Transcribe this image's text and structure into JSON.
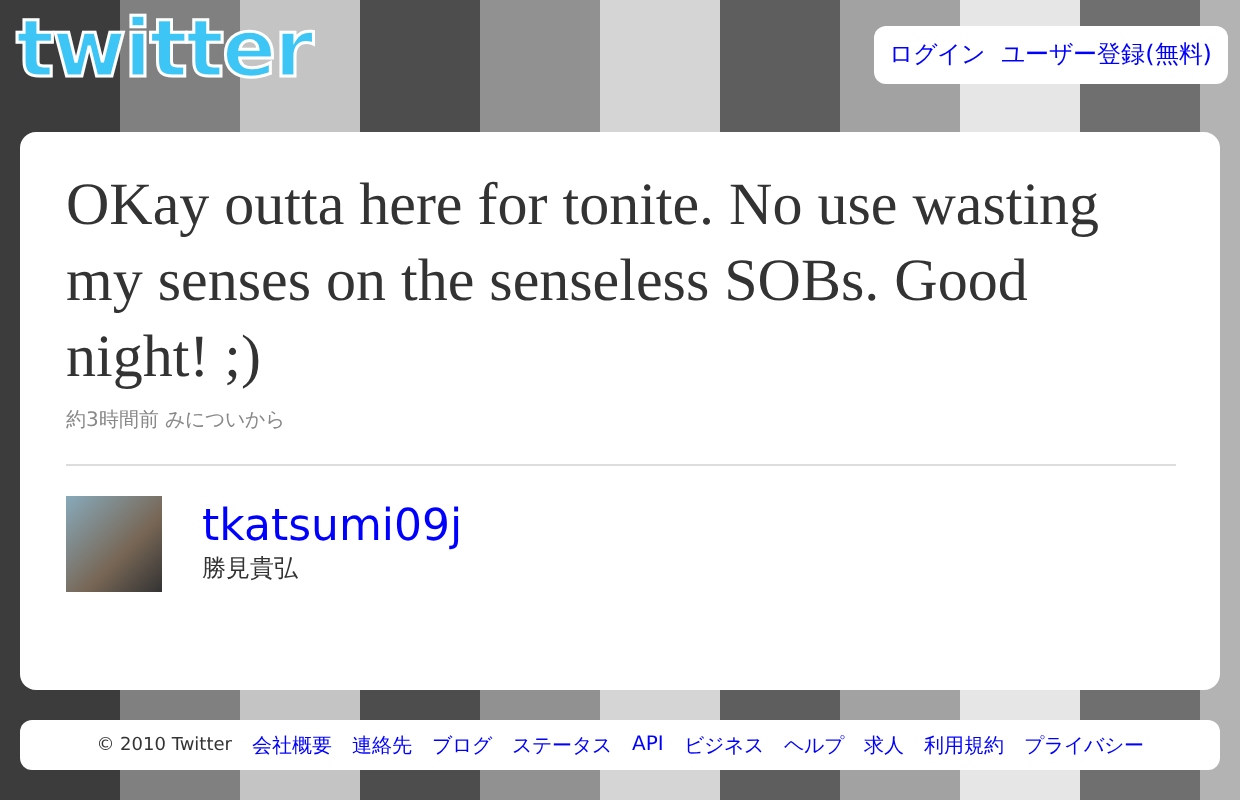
{
  "header": {
    "logo": "twitter",
    "links": [
      "ログイン",
      "ユーザー登録(無料)"
    ]
  },
  "tweet": {
    "text": "OKay outta here for tonite. No use wasting my senses on the senseless SOBs. Good night! ;)",
    "meta": "約3時間前 みについから"
  },
  "author": {
    "username": "tkatsumi09j",
    "name": "勝見貴弘"
  },
  "footer": {
    "copyright": "© 2010 Twitter",
    "links": [
      "会社概要",
      "連絡先",
      "ブログ",
      "ステータス",
      "API",
      "ビジネス",
      "ヘルプ",
      "求人",
      "利用規約",
      "プライバシー"
    ]
  }
}
